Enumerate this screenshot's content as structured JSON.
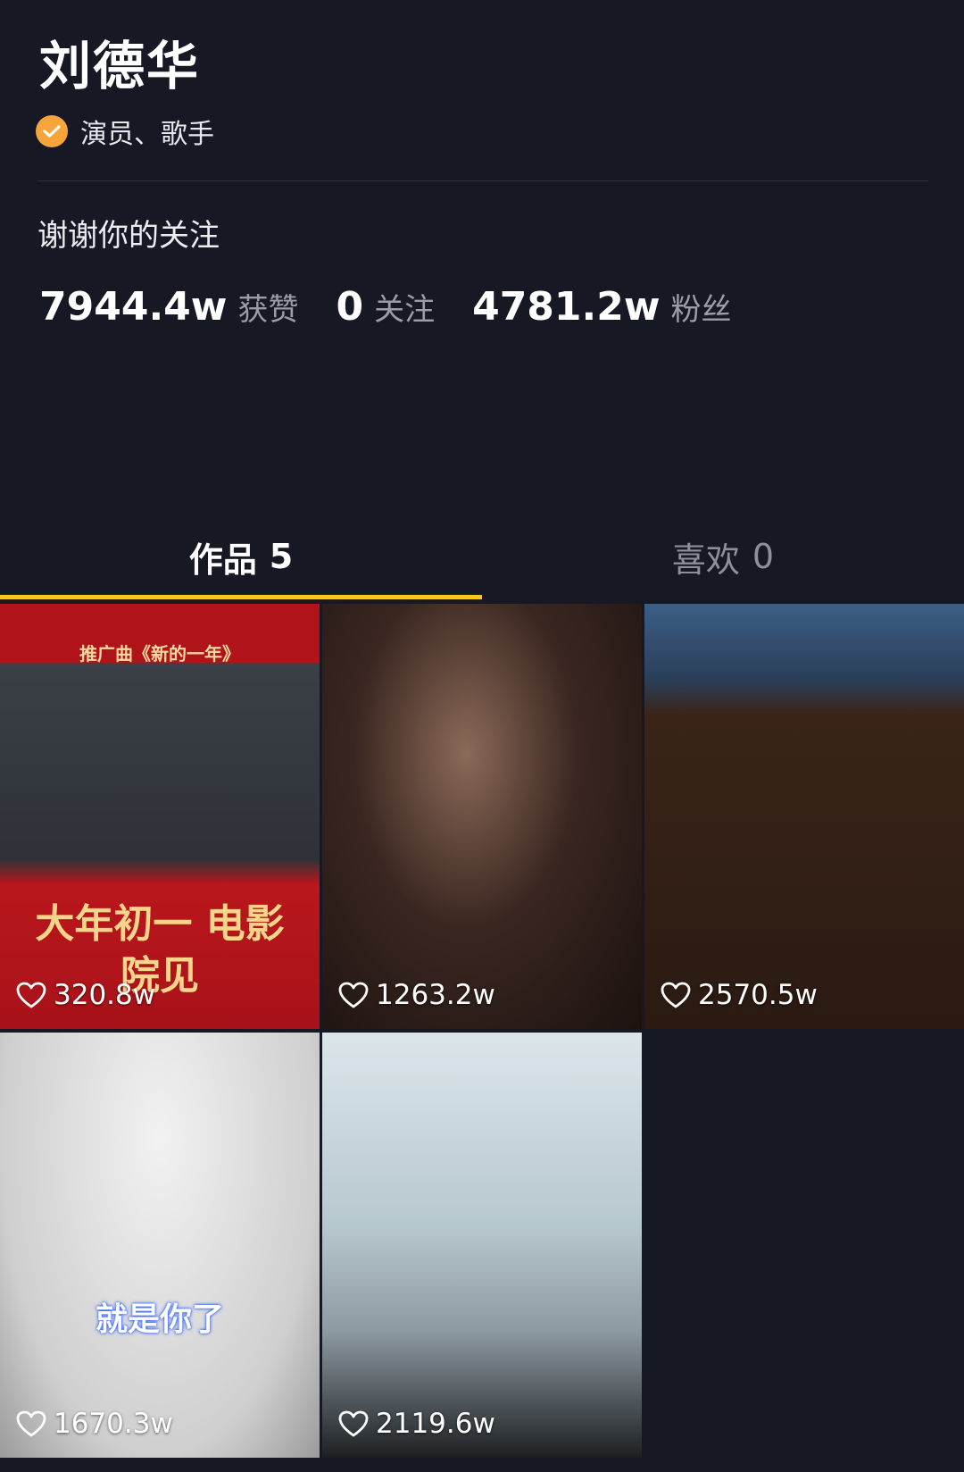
{
  "profile": {
    "name": "刘德华",
    "verify_text": "演员、歌手",
    "bio": "谢谢你的关注",
    "stats": [
      {
        "num": "7944.4w",
        "label": "获赞"
      },
      {
        "num": "0",
        "label": "关注"
      },
      {
        "num": "4781.2w",
        "label": "粉丝"
      }
    ]
  },
  "tabs": [
    {
      "label": "作品",
      "count": "5"
    },
    {
      "label": "喜欢",
      "count": "0"
    }
  ],
  "videos": [
    {
      "likes": "320.8w",
      "overlay_top": "推广曲《新的一年》",
      "overlay_bottom": "大年初一 电影院见"
    },
    {
      "likes": "1263.2w"
    },
    {
      "likes": "2570.5w"
    },
    {
      "likes": "1670.3w",
      "overlay_mid": "就是你了"
    },
    {
      "likes": "2119.6w"
    }
  ],
  "colors": {
    "background": "#161824",
    "verify": "#f7a43b",
    "tab_underline": "#f6c81e"
  }
}
